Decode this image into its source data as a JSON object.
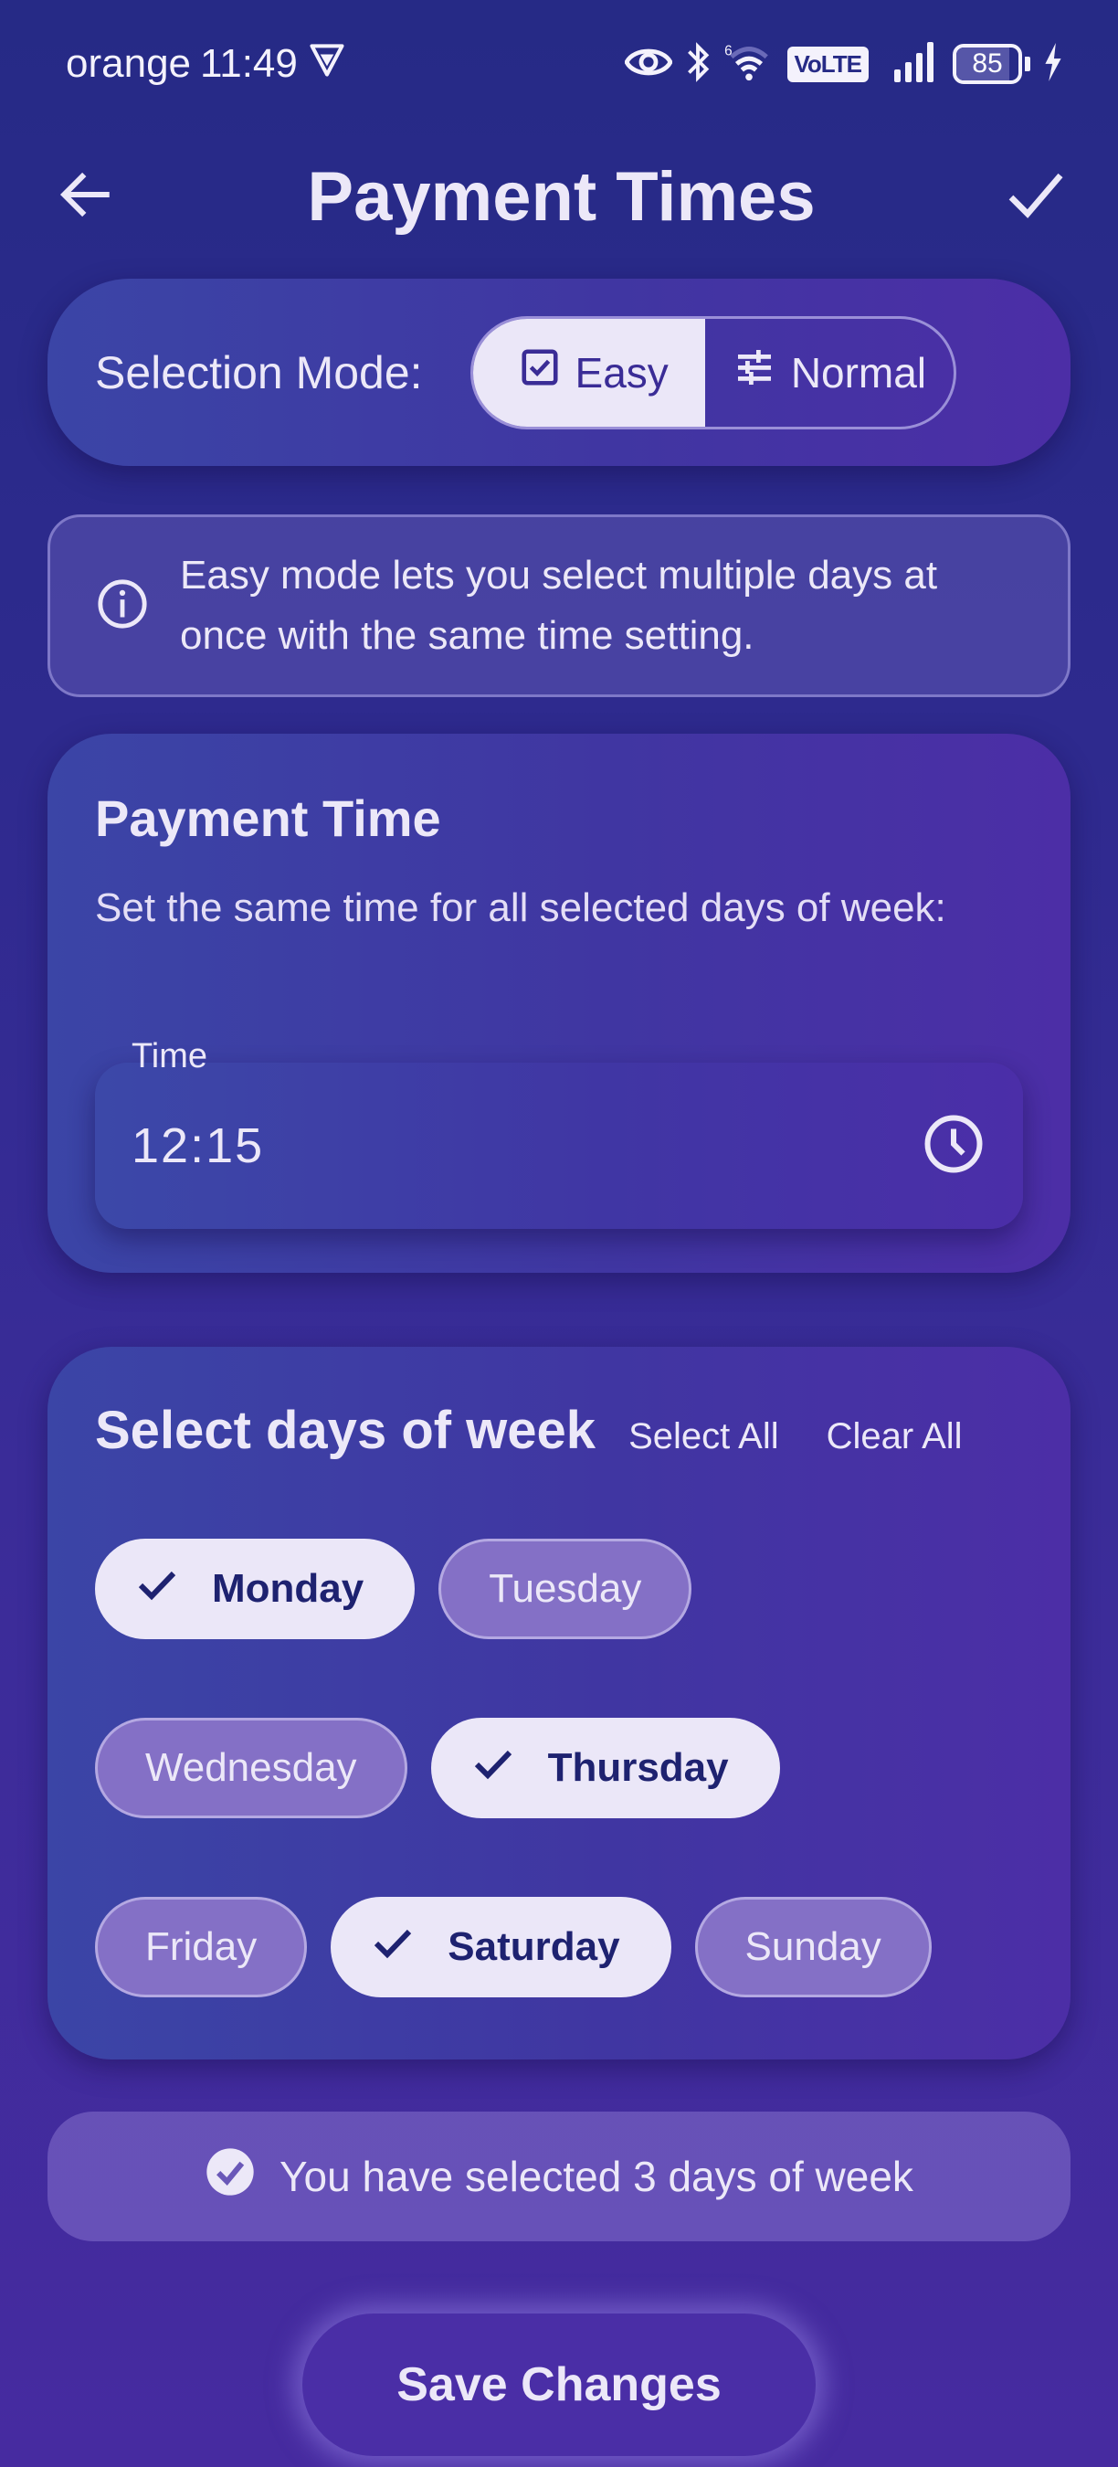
{
  "status_bar": {
    "carrier": "orange",
    "time": "11:49",
    "network_label": "VoLTE",
    "wifi_label": "6",
    "battery_percent": 85
  },
  "app_bar": {
    "title": "Payment Times",
    "back_icon": "arrow-left-icon",
    "confirm_icon": "check-icon"
  },
  "selection_mode": {
    "label": "Selection Mode:",
    "options": [
      {
        "label": "Easy",
        "icon": "checkbox-icon",
        "selected": true
      },
      {
        "label": "Normal",
        "icon": "tune-icon",
        "selected": false
      }
    ]
  },
  "info_banner": {
    "icon": "info-icon",
    "text": "Easy mode lets you select multiple days at once with the same time setting."
  },
  "payment_time": {
    "title": "Payment Time",
    "description": "Set the same time for all selected days of week:",
    "field_label": "Time",
    "value": "12:15",
    "icon": "clock-icon"
  },
  "days": {
    "title": "Select days of week",
    "select_all_label": "Select All",
    "clear_all_label": "Clear All",
    "rows": [
      [
        {
          "label": "Monday",
          "selected": true
        },
        {
          "label": "Tuesday",
          "selected": false
        }
      ],
      [
        {
          "label": "Wednesday",
          "selected": false
        },
        {
          "label": "Thursday",
          "selected": true
        }
      ],
      [
        {
          "label": "Friday",
          "selected": false
        },
        {
          "label": "Saturday",
          "selected": true
        },
        {
          "label": "Sunday",
          "selected": false
        }
      ]
    ]
  },
  "summary": {
    "icon": "check-circle-icon",
    "text": "You have selected 3 days of week"
  },
  "save_button": {
    "label": "Save Changes"
  },
  "colors": {
    "background": "#2e2a8e",
    "card": "#4036a2",
    "chip_selected_bg": "#ebe7f8",
    "chip_selected_text": "#1e2270",
    "chip_unselected_bg": "#8470c6",
    "text": "#ece8f8"
  }
}
